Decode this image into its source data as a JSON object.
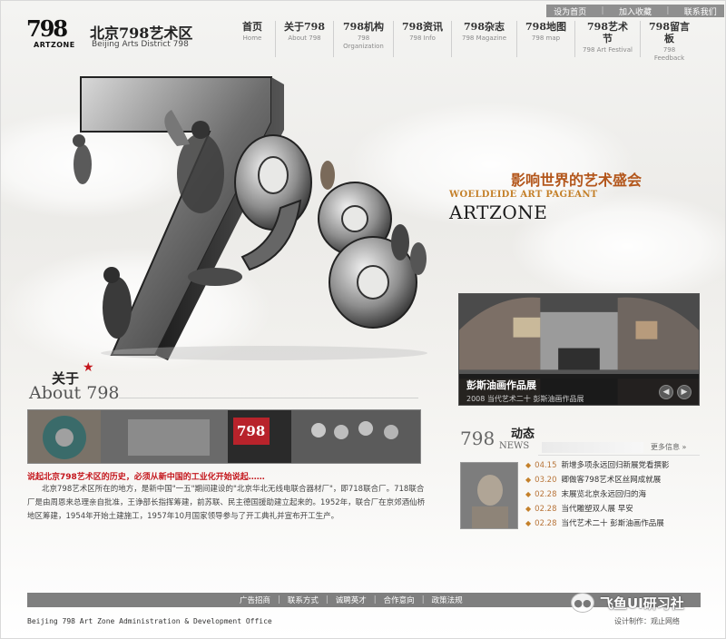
{
  "utility": {
    "set_home": "设为首页",
    "bookmark": "加入收藏",
    "contact": "联系我们"
  },
  "brand": {
    "logo_number": "798",
    "logo_sub": "ARTZONE",
    "name_cn": "北京798艺术区",
    "name_en": "Beijing Arts District 798"
  },
  "nav": [
    {
      "cn": "首页",
      "en": "Home"
    },
    {
      "cn": "关于798",
      "en": "About 798"
    },
    {
      "cn": "798机构",
      "en": "798 Organization"
    },
    {
      "cn": "798资讯",
      "en": "798 Info"
    },
    {
      "cn": "798杂志",
      "en": "798 Magazine"
    },
    {
      "cn": "798地图",
      "en": "798 map"
    },
    {
      "cn": "798艺术节",
      "en": "798 Art Festival"
    },
    {
      "cn": "798留言板",
      "en": "798 Feedback"
    }
  ],
  "hero": {
    "big_number": "798"
  },
  "slogan": {
    "cn": "影响世界的艺术盛会",
    "en": "WOELDEIDE ART PAGEANT",
    "artzone": "ARTZONE"
  },
  "feature": {
    "title": "彭斯油画作品展",
    "subtitle": "2008 当代艺术二十 彭斯油画作品展",
    "prev": "◀",
    "next": "▶"
  },
  "about": {
    "title_cn": "关于",
    "title_en": "About",
    "title_num": "798",
    "strip_label": "798",
    "headline": "说起北京798艺术区的历史，必须从新中国的工业化开始说起……",
    "body": "北京798艺术区所在的地方，是新中国\"一五\"期间建设的\"北京华北无线电联合器材厂\"，即718联合厂。718联合厂是由周恩来总理亲自批准，王诤部长指挥筹建，前苏联、民主德国援助建立起来的。1952年，联合厂在京郊酒仙桥地区筹建，1954年开始土建施工，1957年10月国家领导参与了开工典礼并宣布开工生产。"
  },
  "news": {
    "title_num": "798",
    "title_cn": "动态",
    "title_en": "NEWS",
    "more": "更多信息 »",
    "items": [
      {
        "date": "04.15",
        "text": "新增多项永远回归新展党看撰影"
      },
      {
        "date": "03.20",
        "text": "卿做客798艺术区丝网成就展"
      },
      {
        "date": "02.28",
        "text": "末展览北京永远回归的海"
      },
      {
        "date": "02.28",
        "text": "当代雕塑双人展 早安"
      },
      {
        "date": "02.28",
        "text": "当代艺术二十 彭斯油画作品展"
      }
    ]
  },
  "footer": {
    "links": [
      "广告招商",
      "联系方式",
      "诚聘英才",
      "合作意向",
      "政策法规"
    ],
    "org": "Beijing 798 Art Zone Administration & Development Office",
    "design": "设计制作：观止网络",
    "watermark": "飞鱼UI研习社"
  },
  "colors": {
    "accent_orange": "#b3561b",
    "accent_red": "#c4161c",
    "footer_gray": "#7f7f7f",
    "utility_gray": "#8f8f8f"
  }
}
